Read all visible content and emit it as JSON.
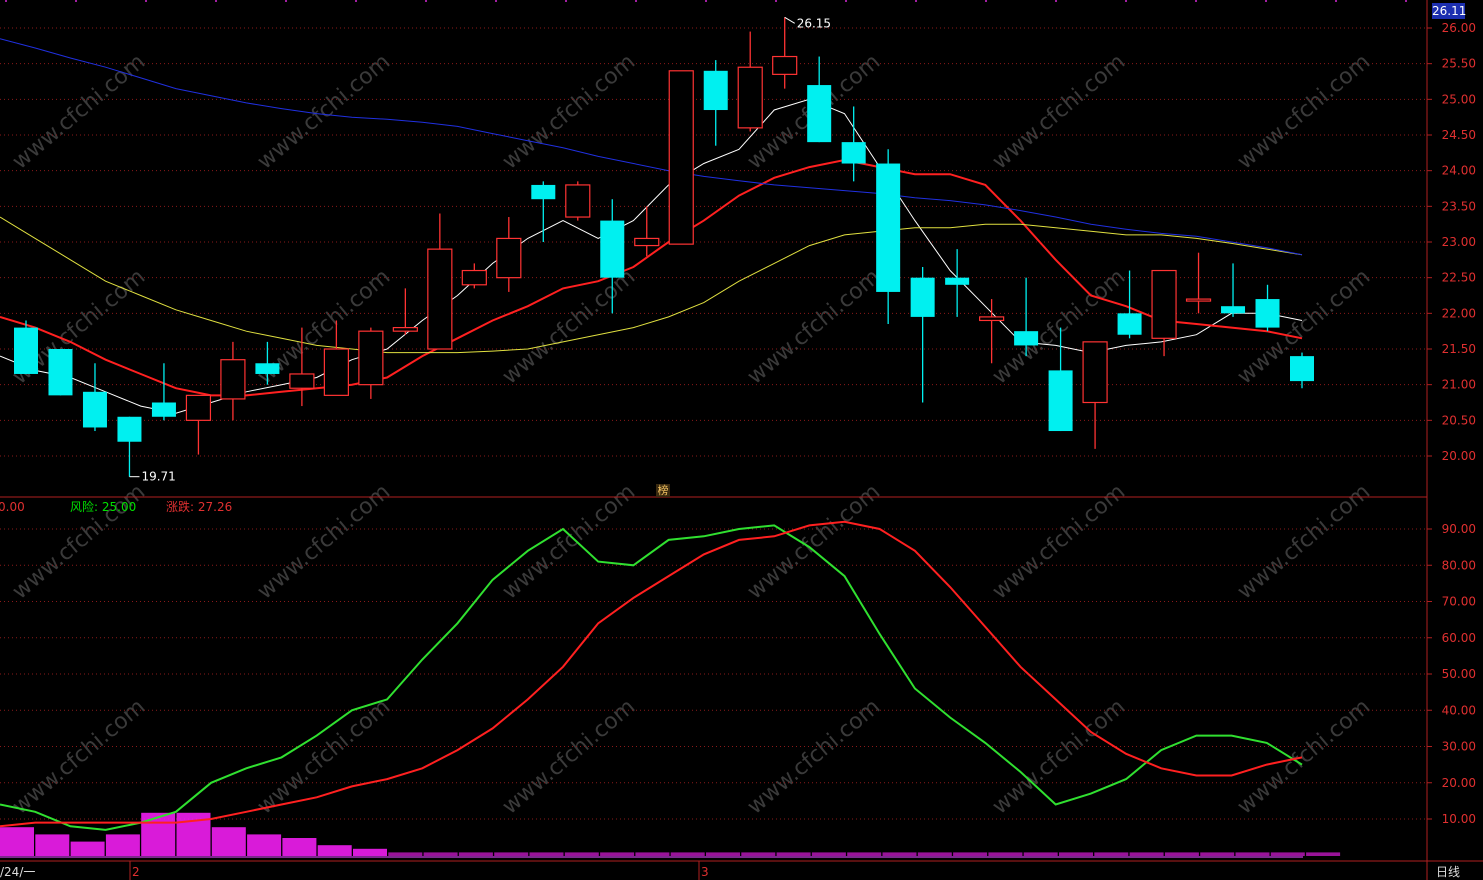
{
  "price_badge": "26.11",
  "period_label": "日线",
  "date_label": "/24/一",
  "bang_label": "榜",
  "month_markers": [
    "2",
    "3"
  ],
  "indicator_legend": [
    {
      "text": "0.00",
      "color": "#e03030"
    },
    {
      "text": "风险: 25.00",
      "color": "#00e000"
    },
    {
      "text": "涨跌: 27.26",
      "color": "#e03030"
    }
  ],
  "annotations": {
    "high": "26.15",
    "low": "19.71"
  },
  "colors": {
    "up": "#ff3333",
    "down": "#00f0f0",
    "ma5": "#ffffff",
    "ma10": "#ff2020",
    "ma30": "#e0e040",
    "ma60": "#2030e0",
    "k": "#30e030",
    "d": "#ff2020",
    "grid": "#8a1a1a",
    "pink": "#ff20ff"
  },
  "chart_data": [
    {
      "type": "candlestick",
      "title": "",
      "ylim": [
        19.5,
        26.2
      ],
      "y_ticks": [
        "26.00",
        "25.50",
        "25.00",
        "24.50",
        "24.00",
        "23.50",
        "23.00",
        "22.50",
        "22.00",
        "21.50",
        "21.00",
        "20.50",
        "20.00"
      ],
      "candles": [
        {
          "o": 21.8,
          "h": 21.9,
          "l": 21.15,
          "c": 21.15
        },
        {
          "o": 21.5,
          "h": 21.5,
          "l": 20.85,
          "c": 20.85
        },
        {
          "o": 20.9,
          "h": 21.3,
          "l": 20.35,
          "c": 20.4
        },
        {
          "o": 20.55,
          "h": 20.55,
          "l": 19.71,
          "c": 20.2
        },
        {
          "o": 20.75,
          "h": 21.3,
          "l": 20.5,
          "c": 20.55
        },
        {
          "o": 20.5,
          "h": 20.85,
          "l": 20.02,
          "c": 20.85
        },
        {
          "o": 20.8,
          "h": 21.6,
          "l": 20.5,
          "c": 21.35
        },
        {
          "o": 21.3,
          "h": 21.6,
          "l": 21.0,
          "c": 21.15
        },
        {
          "o": 20.95,
          "h": 21.8,
          "l": 20.7,
          "c": 21.15
        },
        {
          "o": 20.85,
          "h": 21.9,
          "l": 20.85,
          "c": 21.5
        },
        {
          "o": 21.0,
          "h": 21.8,
          "l": 20.8,
          "c": 21.75
        },
        {
          "o": 21.75,
          "h": 22.35,
          "l": 21.7,
          "c": 21.8
        },
        {
          "o": 21.5,
          "h": 23.4,
          "l": 21.5,
          "c": 22.9
        },
        {
          "o": 22.4,
          "h": 22.7,
          "l": 22.35,
          "c": 22.6
        },
        {
          "o": 22.5,
          "h": 23.35,
          "l": 22.3,
          "c": 23.05
        },
        {
          "o": 23.8,
          "h": 23.85,
          "l": 23.0,
          "c": 23.6
        },
        {
          "o": 23.35,
          "h": 23.85,
          "l": 23.3,
          "c": 23.8
        },
        {
          "o": 23.3,
          "h": 23.6,
          "l": 22.0,
          "c": 22.5
        },
        {
          "o": 22.95,
          "h": 23.5,
          "l": 22.8,
          "c": 23.05
        },
        {
          "o": 22.97,
          "h": 25.4,
          "l": 22.97,
          "c": 25.4
        },
        {
          "o": 25.4,
          "h": 25.55,
          "l": 24.35,
          "c": 24.85
        },
        {
          "o": 24.6,
          "h": 25.95,
          "l": 24.55,
          "c": 25.45
        },
        {
          "o": 25.35,
          "h": 26.15,
          "l": 25.15,
          "c": 25.6
        },
        {
          "o": 25.2,
          "h": 25.6,
          "l": 24.4,
          "c": 24.4
        },
        {
          "o": 24.4,
          "h": 24.9,
          "l": 23.85,
          "c": 24.1
        },
        {
          "o": 24.1,
          "h": 24.3,
          "l": 21.85,
          "c": 22.3
        },
        {
          "o": 22.5,
          "h": 22.65,
          "l": 20.75,
          "c": 21.95
        },
        {
          "o": 22.5,
          "h": 22.9,
          "l": 21.95,
          "c": 22.4
        },
        {
          "o": 21.9,
          "h": 22.2,
          "l": 21.3,
          "c": 21.95
        },
        {
          "o": 21.75,
          "h": 22.5,
          "l": 21.4,
          "c": 21.55
        },
        {
          "o": 21.2,
          "h": 21.8,
          "l": 20.35,
          "c": 20.35
        },
        {
          "o": 20.75,
          "h": 21.6,
          "l": 20.1,
          "c": 21.6
        },
        {
          "o": 22.0,
          "h": 22.6,
          "l": 21.65,
          "c": 21.7
        },
        {
          "o": 21.65,
          "h": 22.6,
          "l": 21.4,
          "c": 22.6
        },
        {
          "o": 22.2,
          "h": 22.85,
          "l": 22.0,
          "c": 22.2
        },
        {
          "o": 22.1,
          "h": 22.7,
          "l": 21.95,
          "c": 22.0
        },
        {
          "o": 22.2,
          "h": 22.4,
          "l": 21.75,
          "c": 21.8
        },
        {
          "o": 21.4,
          "h": 21.45,
          "l": 20.95,
          "c": 21.05
        }
      ],
      "series": [
        {
          "name": "",
          "kind": "ma5",
          "values": [
            21.4,
            21.2,
            21.1,
            20.9,
            20.7,
            20.6,
            20.75,
            20.9,
            21.0,
            21.1,
            21.35,
            21.5,
            21.9,
            22.25,
            22.7,
            23.05,
            23.3,
            23.05,
            23.3,
            23.8,
            24.1,
            24.3,
            24.85,
            25.0,
            24.8,
            24.05,
            23.3,
            22.6,
            22.1,
            21.6,
            21.55,
            21.45,
            21.55,
            21.6,
            21.7,
            22.0,
            22.0,
            21.9
          ]
        },
        {
          "name": "",
          "kind": "ma10",
          "values": [
            21.95,
            21.8,
            21.6,
            21.35,
            21.15,
            20.95,
            20.85,
            20.85,
            20.9,
            20.95,
            21.0,
            21.1,
            21.4,
            21.65,
            21.9,
            22.1,
            22.35,
            22.45,
            22.65,
            23.0,
            23.3,
            23.65,
            23.9,
            24.05,
            24.15,
            24.05,
            23.95,
            23.95,
            23.8,
            23.3,
            22.75,
            22.25,
            22.1,
            21.9,
            21.85,
            21.8,
            21.75,
            21.65
          ]
        },
        {
          "name": "",
          "kind": "ma30",
          "values": [
            23.35,
            23.05,
            22.75,
            22.45,
            22.25,
            22.05,
            21.9,
            21.75,
            21.65,
            21.55,
            21.5,
            21.45,
            21.45,
            21.45,
            21.47,
            21.5,
            21.6,
            21.7,
            21.8,
            21.95,
            22.15,
            22.45,
            22.7,
            22.95,
            23.1,
            23.15,
            23.2,
            23.2,
            23.25,
            23.25,
            23.2,
            23.15,
            23.1,
            23.1,
            23.05,
            22.98,
            22.9,
            22.82
          ]
        },
        {
          "name": "",
          "kind": "ma60",
          "values": [
            25.85,
            25.72,
            25.58,
            25.45,
            25.3,
            25.15,
            25.05,
            24.95,
            24.87,
            24.8,
            24.75,
            24.72,
            24.68,
            24.62,
            24.52,
            24.42,
            24.32,
            24.2,
            24.1,
            24.0,
            23.92,
            23.86,
            23.8,
            23.76,
            23.72,
            23.68,
            23.62,
            23.58,
            23.52,
            23.44,
            23.35,
            23.25,
            23.18,
            23.12,
            23.08,
            23.0,
            22.92,
            22.82
          ]
        }
      ]
    },
    {
      "type": "line",
      "title": "",
      "ylim": [
        0,
        95
      ],
      "y_ticks": [
        "90.00",
        "80.00",
        "70.00",
        "60.00",
        "50.00",
        "40.00",
        "30.00",
        "20.00",
        "10.00"
      ],
      "series": [
        {
          "name": "风险",
          "values": [
            14,
            12,
            8,
            7,
            9,
            12,
            20,
            24,
            27,
            33,
            40,
            43,
            54,
            64,
            76,
            84,
            90,
            81,
            80,
            87,
            88,
            90,
            91,
            85,
            77,
            61,
            46,
            38,
            31,
            23,
            14,
            17,
            21,
            29,
            33,
            33,
            31,
            25
          ]
        },
        {
          "name": "涨跌",
          "values": [
            8,
            9,
            9,
            9,
            9,
            9,
            10,
            12,
            14,
            16,
            19,
            21,
            24,
            29,
            35,
            43,
            52,
            64,
            71,
            77,
            83,
            87,
            88,
            91,
            92,
            90,
            84,
            74,
            63,
            52,
            43,
            34,
            28,
            24,
            22,
            22,
            25,
            27
          ]
        }
      ],
      "bars": [
        8,
        6,
        4,
        6,
        12,
        12,
        8,
        6,
        5,
        3,
        2,
        1,
        1,
        1,
        1,
        1,
        1,
        1,
        1,
        1,
        1,
        1,
        1,
        1,
        1,
        1,
        1,
        1,
        1,
        1,
        1,
        1,
        1,
        1,
        1,
        1,
        1,
        1
      ]
    }
  ]
}
